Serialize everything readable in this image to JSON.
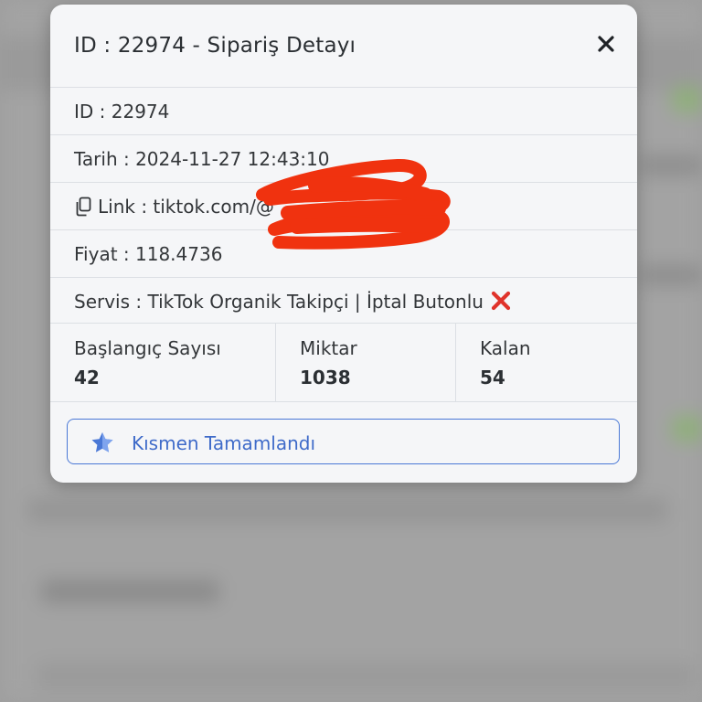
{
  "modal": {
    "title": "ID : 22974 - Sipariş Detayı",
    "close_icon": "close-icon",
    "rows": {
      "id": "ID : 22974",
      "date": "Tarih : 2024-11-27 12:43:10",
      "link": "Link : tiktok.com/@",
      "price": "Fiyat : 118.4736",
      "service": "Servis : TikTok Organik Takipçi | İptal Butonlu"
    },
    "service_icon": "cross-mark-icon",
    "link_icon": "copy-icon",
    "stats": [
      {
        "label": "Başlangıç Sayısı",
        "value": "42"
      },
      {
        "label": "Miktar",
        "value": "1038"
      },
      {
        "label": "Kalan",
        "value": "54"
      }
    ],
    "status_button": {
      "label": "Kısmen Tamamlandı",
      "icon": "star-icon"
    }
  },
  "colors": {
    "accent": "#3f6bc9",
    "star": "#4a78d6",
    "cross": "#e0332b",
    "redaction": "#f0320f"
  }
}
